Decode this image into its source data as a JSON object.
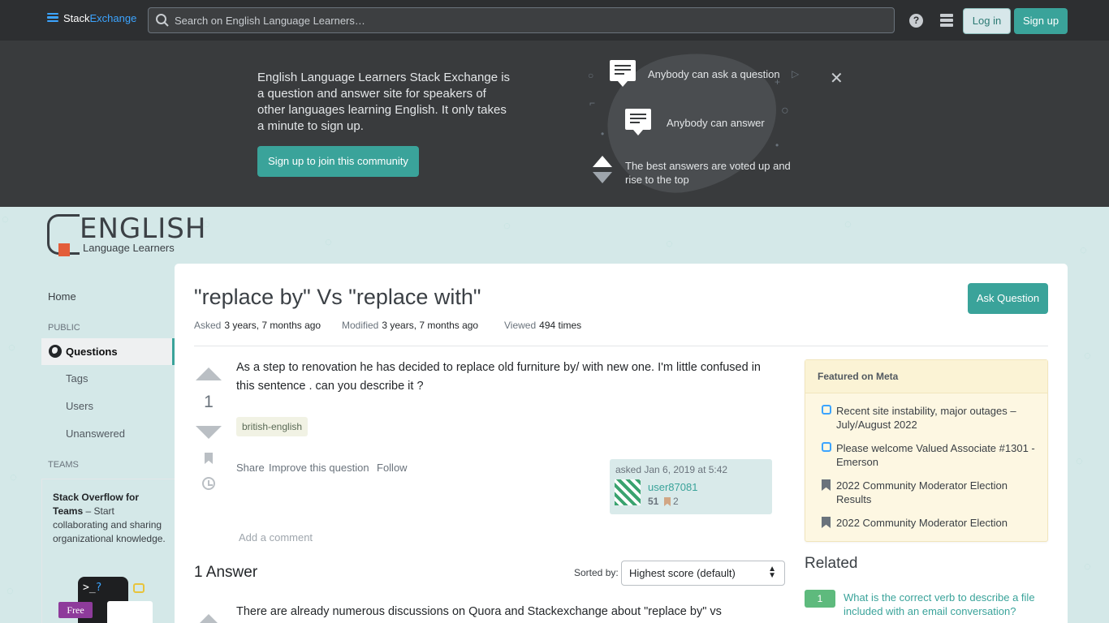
{
  "topbar": {
    "logo_stack": "Stack",
    "logo_exchange": "Exchange",
    "search_placeholder": "Search on English Language Learners…",
    "help_glyph": "?",
    "login_label": "Log in",
    "signup_label": "Sign up"
  },
  "hero": {
    "text": "English Language Learners Stack Exchange is a question and answer site for speakers of other languages learning English. It only takes a minute to sign up.",
    "cta": "Sign up to join this community",
    "feature_ask": "Anybody can ask a question",
    "feature_answer": "Anybody can answer",
    "feature_vote": "The best answers are voted up and rise to the top",
    "close_glyph": "✕"
  },
  "site_logo": {
    "big": "ENGLISH",
    "small": "Language Learners"
  },
  "sidebar": {
    "home": "Home",
    "public_label": "PUBLIC",
    "questions": "Questions",
    "tags": "Tags",
    "users": "Users",
    "unanswered": "Unanswered",
    "teams_label": "TEAMS",
    "teams_title": "Stack Overflow for Teams",
    "teams_desc": " – Start collaborating and sharing organizational knowledge.",
    "teams_prompt": ">_",
    "teams_q": "?",
    "teams_free": "Free"
  },
  "question": {
    "title": "\"replace by\" Vs \"replace with\"",
    "ask_button": "Ask Question",
    "asked_label": "Asked",
    "asked_value": "3 years, 7 months ago",
    "modified_label": "Modified",
    "modified_value": "3 years, 7 months ago",
    "viewed_label": "Viewed",
    "viewed_value": "494 times",
    "votes": "1",
    "body": "As a step to renovation he has decided to replace old furniture by/ with new one. I'm little confused in this sentence . can you describe it ?",
    "tag": "british-english",
    "share": "Share",
    "improve": "Improve this question",
    "follow": "Follow",
    "add_comment": "Add a comment",
    "user": {
      "asked_at": "asked Jan 6, 2019 at 5:42",
      "name": "user87081",
      "rep": "51",
      "bronze": "2"
    }
  },
  "answers": {
    "heading": "1 Answer",
    "sort_label": "Sorted by:",
    "sort_value": "Highest score (default)",
    "first_body": "There are already numerous discussions on Quora and Stackexchange about \"replace by\" vs"
  },
  "featured": {
    "heading": "Featured on Meta",
    "items": [
      "Recent site instability, major outages – July/August 2022",
      "Please welcome Valued Associate #1301 - Emerson",
      "2022 Community Moderator Election Results",
      "2022 Community Moderator Election"
    ]
  },
  "related": {
    "heading": "Related",
    "items": [
      {
        "count": "1",
        "title": "What is the correct verb to describe a file included with an email conversation?"
      }
    ]
  },
  "colors": {
    "accent": "#3aa39a",
    "topbar": "#2d2f31",
    "hero": "#393b3d"
  }
}
